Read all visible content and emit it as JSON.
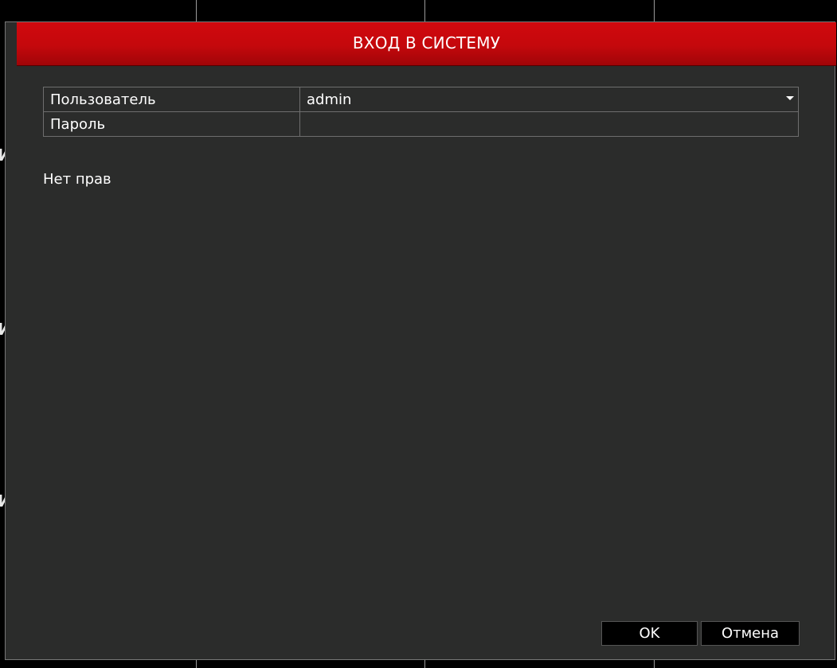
{
  "dialog": {
    "title": "ВХОД В СИСТЕМУ",
    "accent_color": "#c4080c",
    "background_color": "#2b2c2b"
  },
  "form": {
    "user_label": "Пользователь",
    "user_value": "admin",
    "password_label": "Пароль",
    "password_value": ""
  },
  "status": {
    "message": "Нет прав"
  },
  "buttons": {
    "ok_label": "OK",
    "cancel_label": "Отмена"
  },
  "icons": {
    "dropdown": "chevron-down-icon"
  }
}
